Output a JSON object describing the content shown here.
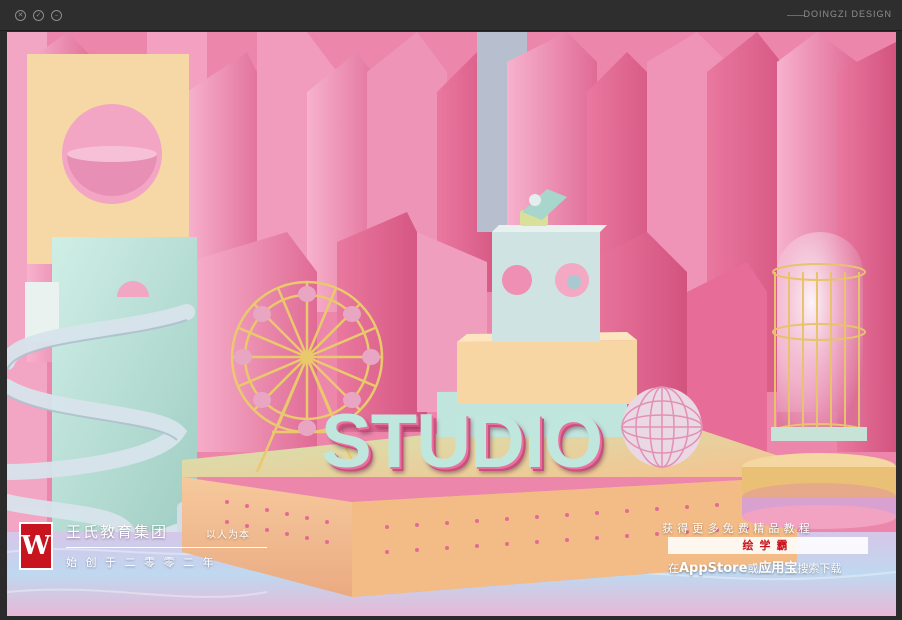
{
  "window": {
    "controls": [
      {
        "name": "close-icon",
        "glyph": "✕"
      },
      {
        "name": "check-icon",
        "glyph": "✓"
      },
      {
        "name": "minus-icon",
        "glyph": "–"
      }
    ],
    "brand": "DOINGZI DESIGN"
  },
  "artwork": {
    "sign_text": "STUDIO",
    "colors": {
      "background_pink": "#e8789f",
      "platform_peach": "#f5c8a0",
      "mint": "#bfe7de",
      "gold": "#e8c86a",
      "logo_red": "#c8141e"
    }
  },
  "overlay": {
    "logo_letter": "W",
    "company_name": "王氏教育集团",
    "motto": "以人为本",
    "founded": "始创于二零零二年",
    "promo_line1": "获得更多免费精品教程",
    "promo_line2": "绘学霸",
    "promo_line3_pre": "在",
    "promo_line3_appstore": "AppStore",
    "promo_line3_mid": "或",
    "promo_line3_store": "应用宝",
    "promo_line3_post": "搜索下载"
  }
}
